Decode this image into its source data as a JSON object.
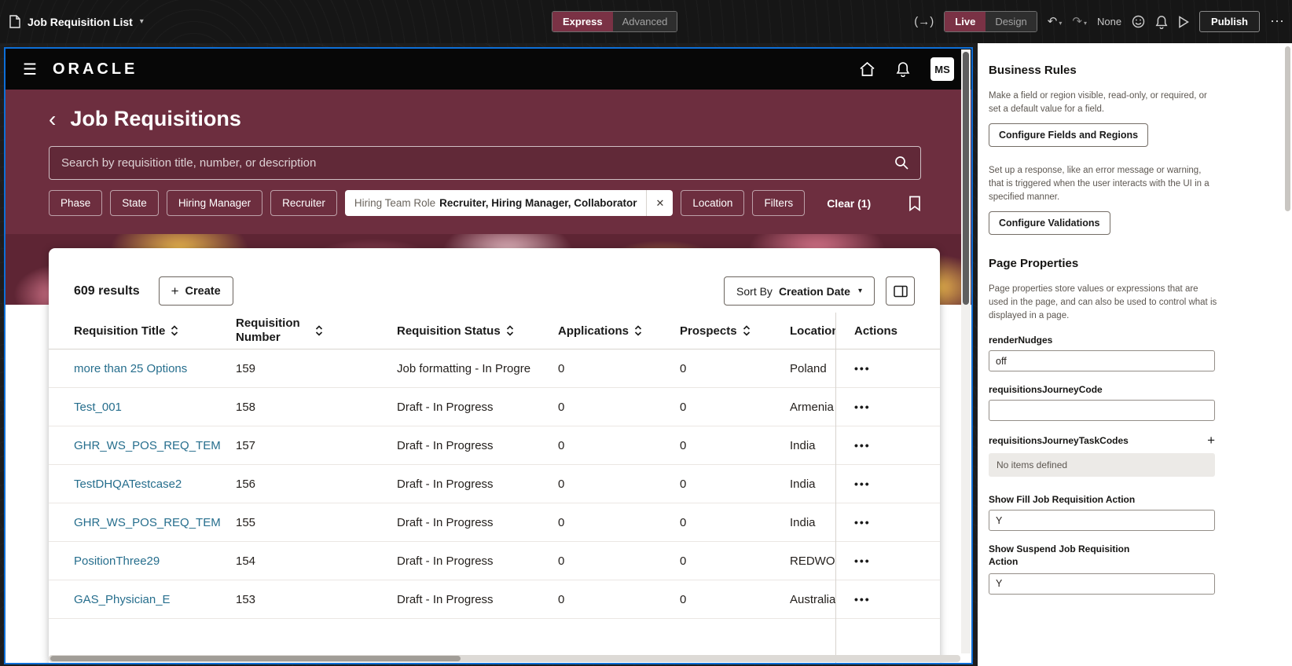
{
  "builder": {
    "page_selector": "Job Requisition List",
    "mode": {
      "express": "Express",
      "advanced": "Advanced"
    },
    "view": {
      "live": "Live",
      "design": "Design"
    },
    "layout_label": "None",
    "publish": "Publish"
  },
  "icons": {
    "hamburger": "☰",
    "caret_down": "▾",
    "back": "‹",
    "plus": "+",
    "close": "✕",
    "kebab": "•••",
    "undo": "↶",
    "redo": "↷",
    "code_toggle": "(→)",
    "overflow": "⋯"
  },
  "app": {
    "brand": "ORACLE",
    "avatar": "MS",
    "title": "Job Requisitions",
    "search_placeholder": "Search by requisition title, number, or description",
    "chips": [
      "Phase",
      "State",
      "Hiring Manager",
      "Recruiter"
    ],
    "active_chip": {
      "label": "Hiring Team Role",
      "value": "Recruiter, Hiring Manager, Collaborator"
    },
    "chips_after": [
      "Location",
      "Filters"
    ],
    "clear": "Clear (1)",
    "results": "609 results",
    "create": "Create",
    "sort_by": "Sort By",
    "sort_value": "Creation Date",
    "columns": [
      {
        "label": "Requisition Title"
      },
      {
        "label": "Requisition Number"
      },
      {
        "label": "Requisition Status"
      },
      {
        "label": "Applications"
      },
      {
        "label": "Prospects"
      },
      {
        "label": "Location"
      },
      {
        "label": "Actions"
      }
    ],
    "rows": [
      {
        "title": "more than 25 Options",
        "number": "159",
        "status": "Job formatting - In Progre",
        "applications": "0",
        "prospects": "0",
        "location": "Poland"
      },
      {
        "title": "Test_001",
        "number": "158",
        "status": "Draft - In Progress",
        "applications": "0",
        "prospects": "0",
        "location": "Armenia"
      },
      {
        "title": "GHR_WS_POS_REQ_TEM",
        "number": "157",
        "status": "Draft - In Progress",
        "applications": "0",
        "prospects": "0",
        "location": "India"
      },
      {
        "title": "TestDHQATestcase2",
        "number": "156",
        "status": "Draft - In Progress",
        "applications": "0",
        "prospects": "0",
        "location": "India"
      },
      {
        "title": "GHR_WS_POS_REQ_TEM",
        "number": "155",
        "status": "Draft - In Progress",
        "applications": "0",
        "prospects": "0",
        "location": "India"
      },
      {
        "title": "PositionThree29",
        "number": "154",
        "status": "Draft - In Progress",
        "applications": "0",
        "prospects": "0",
        "location": "REDWO"
      },
      {
        "title": "GAS_Physician_E",
        "number": "153",
        "status": "Draft - In Progress",
        "applications": "0",
        "prospects": "0",
        "location": "Australia"
      }
    ]
  },
  "inspector": {
    "business_rules_title": "Business Rules",
    "fields_help": "Make a field or region visible, read-only, or required, or set a default value for a field.",
    "fields_button": "Configure Fields and Regions",
    "validations_help": "Set up a response, like an error message or warning, that is triggered when the user interacts with the UI in a specified manner.",
    "validations_button": "Configure Validations",
    "page_properties_title": "Page Properties",
    "page_properties_help": "Page properties store values or expressions that are used in the page, and can also be used to control what is displayed in a page.",
    "properties": [
      {
        "label": "renderNudges",
        "value": "off"
      },
      {
        "label": "requisitionsJourneyCode",
        "value": ""
      },
      {
        "label": "requisitionsJourneyTaskCodes",
        "value": "No items defined"
      },
      {
        "label": "Show Fill Job Requisition Action",
        "value": "Y"
      },
      {
        "label": "Show Suspend Job Requisition Action",
        "value": "Y"
      }
    ]
  }
}
